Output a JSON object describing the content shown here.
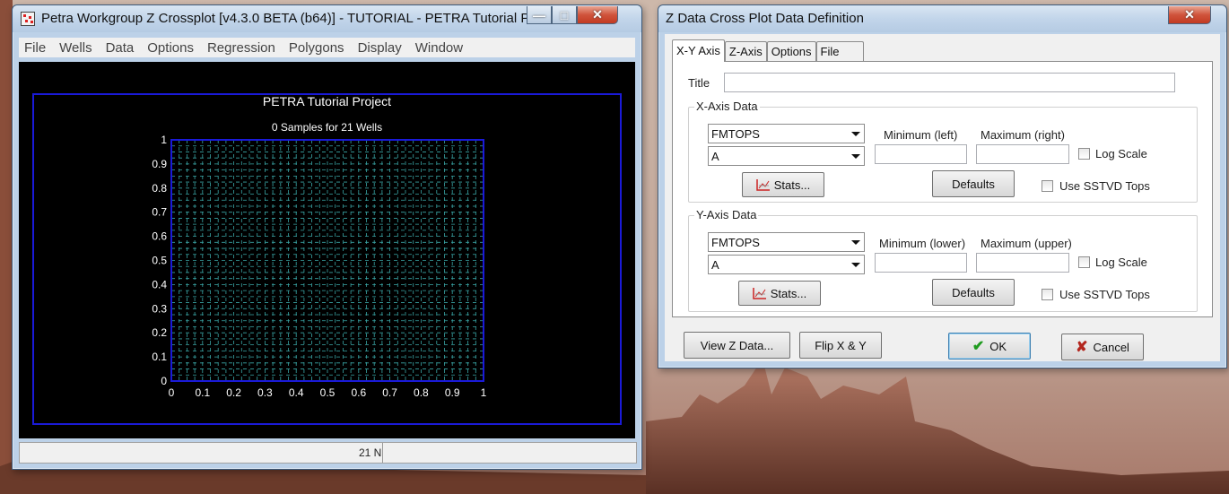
{
  "crossplot_window": {
    "title": "Petra Workgroup Z Crossplot [v4.3.0 BETA (b64)] - TUTORIAL - PETRA Tutorial Pr...",
    "menu": [
      "File",
      "Wells",
      "Data",
      "Options",
      "Regression",
      "Polygons",
      "Display",
      "Window"
    ],
    "status_text": "21 N"
  },
  "chart_data": {
    "type": "scatter",
    "title": "PETRA Tutorial Project",
    "subtitle": "0 Samples for 21 Wells",
    "xlim": [
      0,
      1
    ],
    "ylim": [
      0,
      1
    ],
    "x_ticks": [
      "0",
      "0.1",
      "0.2",
      "0.3",
      "0.4",
      "0.5",
      "0.6",
      "0.7",
      "0.8",
      "0.9",
      "1"
    ],
    "y_ticks": [
      "0",
      "0.1",
      "0.2",
      "0.3",
      "0.4",
      "0.5",
      "0.6",
      "0.7",
      "0.8",
      "0.9",
      "1"
    ],
    "grid": true,
    "points": [],
    "colors": {
      "background": "#000000",
      "frame": "#1a1ad8",
      "grid": "#3aa6a6",
      "text": "#ffffff"
    }
  },
  "dialog": {
    "title": "Z Data Cross Plot Data Definition",
    "tabs": [
      "X-Y Axis",
      "Z-Axis",
      "Options",
      "File"
    ],
    "title_label": "Title",
    "title_value": "",
    "x_axis": {
      "group_label": "X-Axis Data",
      "source": "FMTOPS",
      "field": "A",
      "min_label": "Minimum (left)",
      "max_label": "Maximum (right)",
      "min_value": "",
      "max_value": "",
      "log_scale_label": "Log Scale",
      "stats_label": "Stats...",
      "defaults_label": "Defaults",
      "sstvd_label": "Use SSTVD Tops"
    },
    "y_axis": {
      "group_label": "Y-Axis Data",
      "source": "FMTOPS",
      "field": "A",
      "min_label": "Minimum (lower)",
      "max_label": "Maximum (upper)",
      "min_value": "",
      "max_value": "",
      "log_scale_label": "Log Scale",
      "stats_label": "Stats...",
      "defaults_label": "Defaults",
      "sstvd_label": "Use SSTVD Tops"
    },
    "buttons": {
      "view_z": "View Z Data...",
      "flip": "Flip X & Y",
      "ok": "OK",
      "cancel": "Cancel"
    }
  }
}
